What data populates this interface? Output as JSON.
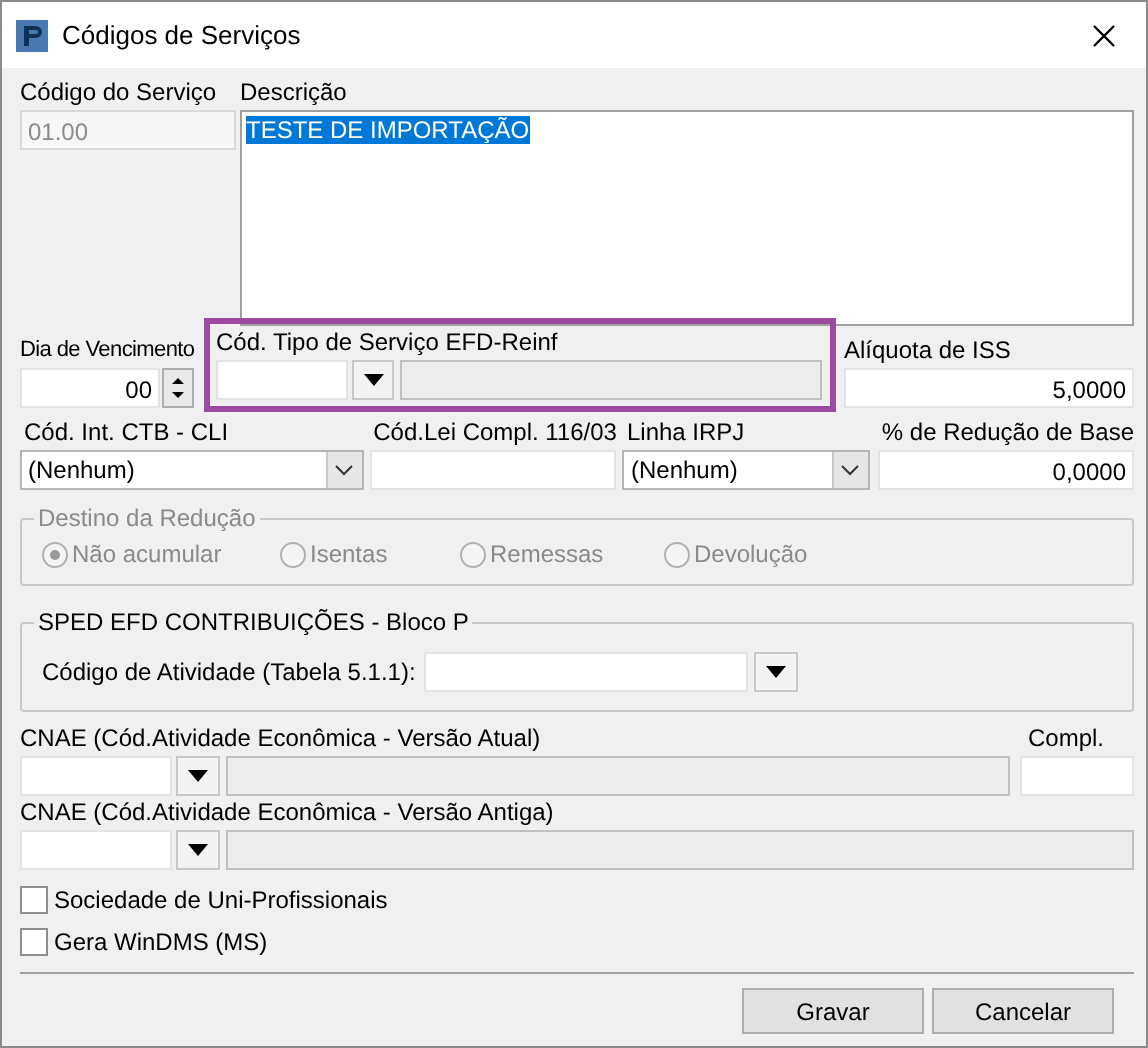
{
  "window": {
    "title": "Códigos de Serviços"
  },
  "codigo_servico": {
    "label": "Código do Serviço",
    "value": "01.00",
    "disabled": true
  },
  "descricao": {
    "label": "Descrição",
    "value": "TESTE DE IMPORTAÇÃO",
    "selected": true
  },
  "dia_vencimento": {
    "label": "Dia de Vencimento",
    "value": "00"
  },
  "tipo_servico_reinf": {
    "label": "Cód. Tipo de Serviço EFD-Reinf",
    "highlighted": true
  },
  "aliquota_iss": {
    "label": "Alíquota de ISS",
    "value": "5,0000"
  },
  "cod_int_ctb": {
    "label": "Cód. Int. CTB - CLI",
    "value": "(Nenhum)"
  },
  "cod_lei": {
    "label": "Cód.Lei Compl. 116/03"
  },
  "linha_irpj": {
    "label": "Linha IRPJ",
    "value": "(Nenhum)"
  },
  "reducao_base": {
    "label": "% de Redução de Base",
    "value": "0,0000"
  },
  "destino_reducao": {
    "title": "Destino da Redução",
    "disabled": true,
    "options": [
      {
        "label": "Não acumular",
        "selected": true
      },
      {
        "label": "Isentas",
        "selected": false
      },
      {
        "label": "Remessas",
        "selected": false
      },
      {
        "label": "Devolução",
        "selected": false
      }
    ]
  },
  "sped": {
    "title": "SPED EFD CONTRIBUIÇÕES - Bloco P",
    "field_label": "Código de Atividade (Tabela 5.1.1):"
  },
  "cnae_atual": {
    "label": "CNAE (Cód.Atividade Econômica - Versão Atual)"
  },
  "compl": {
    "label": "Compl."
  },
  "cnae_antiga": {
    "label": "CNAE (Cód.Atividade Econômica - Versão Antiga)"
  },
  "checkboxes": [
    {
      "label": "Sociedade de Uni-Profissionais",
      "checked": false
    },
    {
      "label": "Gera WinDMS (MS)",
      "checked": false
    }
  ],
  "buttons": [
    "Gravar",
    "Cancelar"
  ]
}
